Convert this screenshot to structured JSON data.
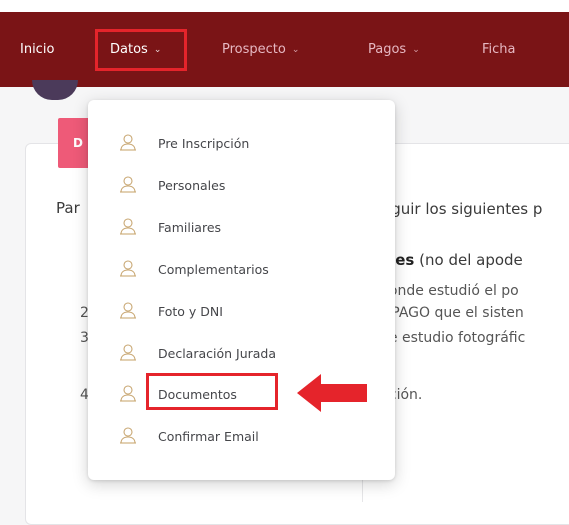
{
  "nav": {
    "items": [
      {
        "label": "Inicio",
        "dropdown": false
      },
      {
        "label": "Datos",
        "dropdown": true
      },
      {
        "label": "Prospecto",
        "dropdown": true
      },
      {
        "label": "Pagos",
        "dropdown": true
      },
      {
        "label": "Ficha",
        "dropdown": false
      }
    ],
    "active": "Datos",
    "chevron_icon": "chevron-down-icon"
  },
  "background": {
    "button_fragment": "D",
    "intro_prefix": "Par",
    "intro_suffix": "eguir los siguientes p",
    "line_bold": "ales",
    "line_rest": " (no del apode",
    "line_2": "donde estudió el po",
    "line_3": "E PAGO que el sisten",
    "line_4": "de estudio fotográfic",
    "line_5": "pción.",
    "num_2": "2",
    "num_3": "3",
    "num_4": "4"
  },
  "dropdown": {
    "icon": "user-outline-icon",
    "items": [
      "Pre Inscripción",
      "Personales",
      "Familiares",
      "Complementarios",
      "Foto y DNI",
      "Declaración Jurada",
      "Documentos",
      "Confirmar Email"
    ],
    "highlighted": "Documentos"
  },
  "colors": {
    "navbar": "#7a1416",
    "nav_text": "#e6b8c2",
    "highlight": "#e5242b",
    "pink_button": "#ee5a78"
  }
}
